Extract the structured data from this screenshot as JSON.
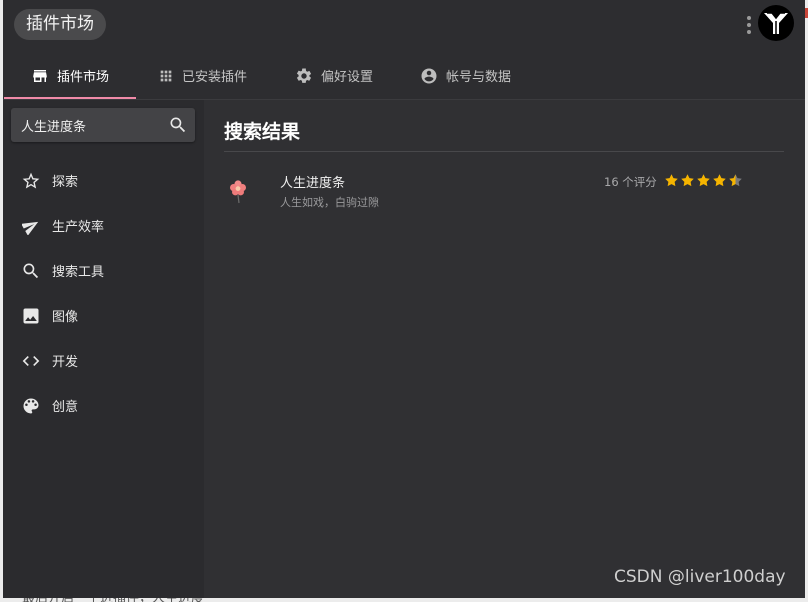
{
  "backdrop": {
    "text": "最后开启一个进插件，人生进度"
  },
  "header": {
    "app_title": "插件市场",
    "menu_icon": "more-vert-icon",
    "logo_icon": "utools-logo-icon"
  },
  "tabs": [
    {
      "label": "插件市场",
      "icon": "store-icon",
      "active": true
    },
    {
      "label": "已安装插件",
      "icon": "apps-grid-icon",
      "active": false
    },
    {
      "label": "偏好设置",
      "icon": "gear-icon",
      "active": false
    },
    {
      "label": "帐号与数据",
      "icon": "account-circle-icon",
      "active": false
    }
  ],
  "sidebar": {
    "search": {
      "value": "人生进度条",
      "icon": "search-icon"
    },
    "items": [
      {
        "label": "探索",
        "icon": "star-outline-icon"
      },
      {
        "label": "生产效率",
        "icon": "send-icon"
      },
      {
        "label": "搜索工具",
        "icon": "search-icon"
      },
      {
        "label": "图像",
        "icon": "image-icon"
      },
      {
        "label": "开发",
        "icon": "code-icon"
      },
      {
        "label": "创意",
        "icon": "palette-icon"
      }
    ]
  },
  "main": {
    "section_title": "搜索结果",
    "results": [
      {
        "title": "人生进度条",
        "description": "人生如戏，白驹过隙",
        "rating_count_text": "16 个评分",
        "rating": 4.5,
        "icon": "flower-icon"
      }
    ]
  },
  "watermark": "CSDN @liver100day",
  "colors": {
    "tab_underline": "#f08aa8",
    "star": "#f5b400",
    "background": "#303033"
  }
}
